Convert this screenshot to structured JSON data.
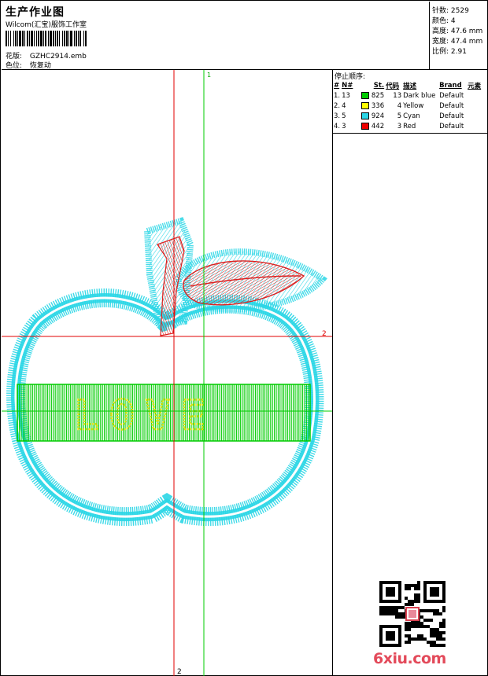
{
  "header": {
    "title": "生产作业图",
    "company": "Wilcom(汇宝)服饰工作室",
    "pattern_label": "花版:",
    "pattern_value": "GZHC2914.emb",
    "colorway_label": "色位:",
    "colorway_value": "恢复动"
  },
  "stats": {
    "stitches": "针数: 2529",
    "colors": "颜色: 4",
    "height": "高度: 47.6 mm",
    "width": "宽度: 47.4 mm",
    "scale": "比例: 2.91"
  },
  "stop_sequence": {
    "title": "停止顺序:",
    "headers": [
      "#",
      "N#",
      "St.",
      "代码",
      "描述",
      "Brand",
      "元素"
    ],
    "rows": [
      {
        "idx": "1.",
        "n": "13",
        "st": "825",
        "code": "13",
        "desc": "Dark blue",
        "brand": "Default",
        "color": "#00cc00"
      },
      {
        "idx": "2.",
        "n": "4",
        "st": "336",
        "code": "4",
        "desc": "Yellow",
        "brand": "Default",
        "color": "#ffff00"
      },
      {
        "idx": "3.",
        "n": "5",
        "st": "924",
        "code": "5",
        "desc": "Cyan",
        "brand": "Default",
        "color": "#2ad6e6"
      },
      {
        "idx": "4.",
        "n": "3",
        "st": "442",
        "code": "3",
        "desc": "Red",
        "brand": "Default",
        "color": "#ee0000"
      }
    ]
  },
  "design": {
    "text": "LOVE",
    "guide_green_label": "1",
    "guide_red_h_label": "2",
    "guide_red_v_label": "2",
    "colors": {
      "outline": "#2ad6e6",
      "band": "#00cc00",
      "letters": "#e0e000",
      "stem": "#dd2020",
      "guide_red": "#e00000",
      "guide_green": "#00cc00"
    }
  },
  "watermark": "6xiu.com"
}
